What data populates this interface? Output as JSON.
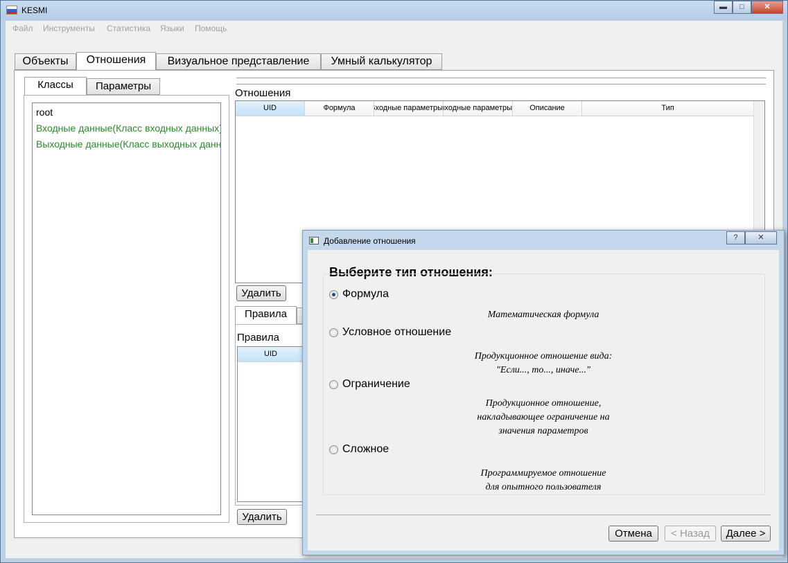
{
  "app": {
    "title": "KESMI",
    "brand_colors": [
      "#ffffff",
      "#2f5fd0",
      "#dd2222"
    ]
  },
  "window_controls": {
    "minimize": "▬",
    "maximize": "□",
    "close": "✕"
  },
  "menu": [
    "Файл",
    "Инструменты",
    "Статистика",
    "Языки",
    "Помощь"
  ],
  "main_tabs": [
    "Объекты",
    "Отношения",
    "Визуальное представление",
    "Умный калькулятор"
  ],
  "left_tabs": [
    "Классы",
    "Параметры"
  ],
  "class_list": [
    {
      "text": "root",
      "color": "#000000"
    },
    {
      "text": "Входные данные(Класс входных данных)",
      "color": "#2a8a2a"
    },
    {
      "text": "Выходные данные(Класс выходных данных)",
      "color": "#2a8a2a"
    }
  ],
  "relations": {
    "title": "Отношения",
    "columns": [
      "UID",
      "Формула",
      "Входные параметры",
      "Выходные параметры",
      "Описание",
      "Тип"
    ],
    "delete_label": "Удалить"
  },
  "rules": {
    "tab": "Правила",
    "title": "Правила",
    "columns": [
      "UID"
    ],
    "delete_label": "Удалить"
  },
  "dialog": {
    "title": "Добавление отношения",
    "help": "?",
    "close": "✕",
    "heading": "Выберите тип отношения:",
    "options": [
      {
        "label": "Формула",
        "checked": true,
        "description": [
          "Математическая формула"
        ]
      },
      {
        "label": "Условное отношение",
        "checked": false,
        "description": [
          "Продукционное отношение вида:",
          "\"Если..., то..., иначе...\""
        ]
      },
      {
        "label": "Ограничение",
        "checked": false,
        "description": [
          "Продукционное отношение,",
          "накладывающее ограничение на",
          "значения параметров"
        ]
      },
      {
        "label": "Сложное",
        "checked": false,
        "description": [
          "Программируемое отношение",
          "для опытного пользователя"
        ]
      }
    ],
    "buttons": {
      "cancel": "Отмена",
      "back": "< Назад",
      "next": "Далее >"
    }
  }
}
